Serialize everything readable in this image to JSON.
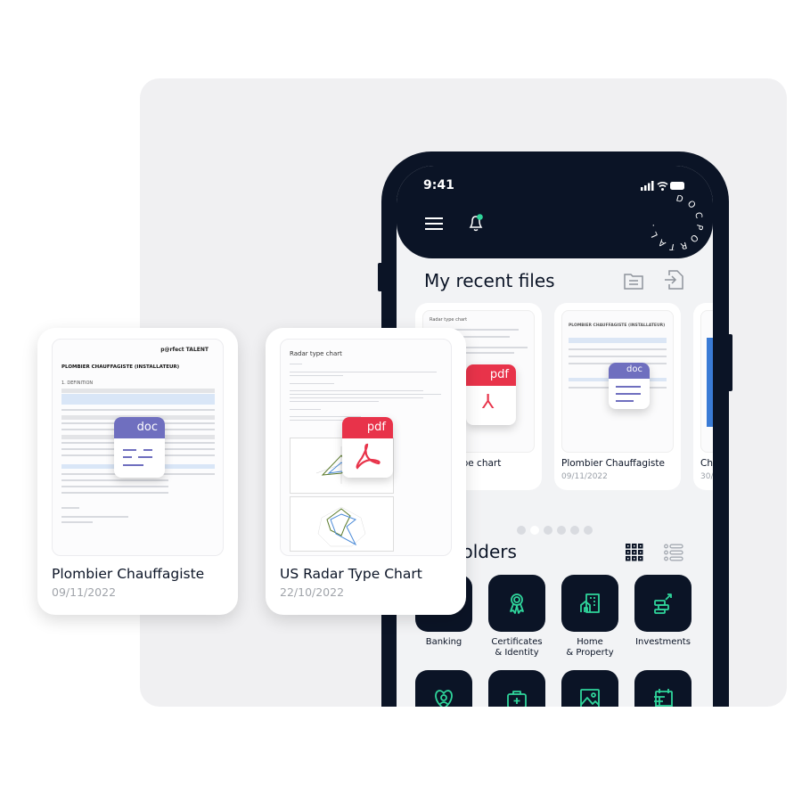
{
  "status_bar": {
    "time": "9:41"
  },
  "logo": {
    "text": "DOCPORTAL ."
  },
  "recent": {
    "title": "My recent files",
    "files": [
      {
        "name": "Radar type chart",
        "date": "",
        "type": "pdf",
        "doc_heading": "Radar type chart"
      },
      {
        "name": "Plombier Chauffagiste",
        "date": "09/11/2022",
        "type": "doc",
        "doc_heading": "PLOMBIER CHAUFFAGISTE (INSTALLATEUR)"
      },
      {
        "name": "Ch",
        "date": "30/",
        "type": ""
      }
    ],
    "page_count": 6,
    "active_page": 2
  },
  "folders": {
    "title": "My folders",
    "items": [
      {
        "label": "Banking",
        "icon": "bank-icon"
      },
      {
        "label": "Certificates\n& Identity",
        "icon": "award-icon"
      },
      {
        "label": "Home\n& Property",
        "icon": "building-icon"
      },
      {
        "label": "Investments",
        "icon": "investment-icon"
      },
      {
        "label": "",
        "icon": "heart-person-icon"
      },
      {
        "label": "",
        "icon": "medical-kit-icon"
      },
      {
        "label": "",
        "icon": "image-icon"
      },
      {
        "label": "",
        "icon": "calendar-icon"
      }
    ]
  },
  "overlay_cards": [
    {
      "name": "Plombier Chauffagiste",
      "date": "09/11/2022",
      "type": "doc",
      "brand": "p@rfect TALENT",
      "heading": "PLOMBIER CHAUFFAGISTE (INSTALLATEUR)",
      "section": "1. DEFINITION"
    },
    {
      "name": "US Radar Type Chart",
      "date": "22/10/2022",
      "type": "pdf",
      "heading": "Radar type chart"
    }
  ],
  "badges": {
    "doc": "doc",
    "pdf": "pdf"
  },
  "colors": {
    "navy": "#0b1426",
    "accent": "#2fd59b",
    "doc": "#6f6fbf",
    "pdf": "#e8334a"
  }
}
